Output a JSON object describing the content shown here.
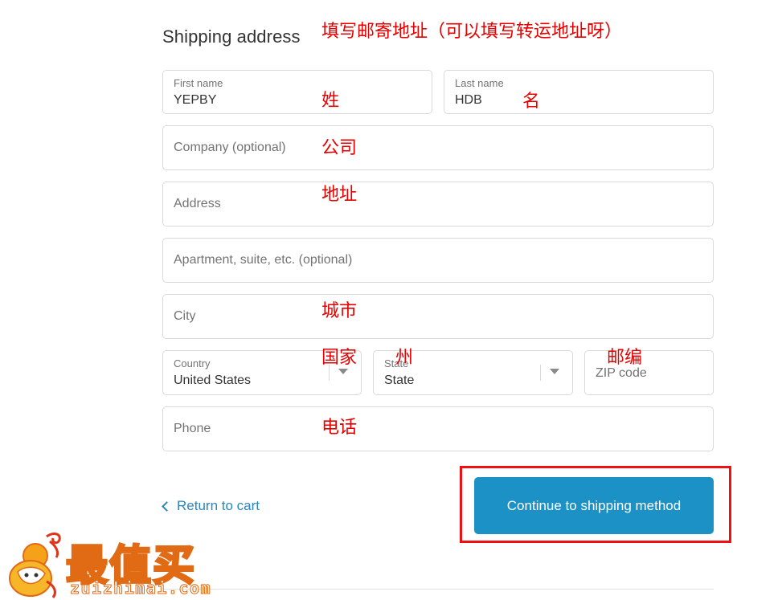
{
  "section": {
    "title": "Shipping address"
  },
  "form": {
    "first_name": {
      "label": "First name",
      "value": "YEPBY"
    },
    "last_name": {
      "label": "Last name",
      "value": "HDB"
    },
    "company": {
      "placeholder": "Company (optional)"
    },
    "address": {
      "placeholder": "Address"
    },
    "apartment": {
      "placeholder": "Apartment, suite, etc. (optional)"
    },
    "city": {
      "placeholder": "City"
    },
    "country": {
      "label": "Country",
      "value": "United States"
    },
    "state": {
      "label": "State",
      "value": "State"
    },
    "zip": {
      "placeholder": "ZIP code"
    },
    "phone": {
      "placeholder": "Phone"
    }
  },
  "annotations": {
    "header": "填写邮寄地址（可以填写转运地址呀）",
    "surname": "姓",
    "given_name": "名",
    "company": "公司",
    "address": "地址",
    "city": "城市",
    "country": "国家",
    "state": "州",
    "zip": "邮编",
    "phone": "电话"
  },
  "actions": {
    "return_label": "Return to cart",
    "continue_label": "Continue to shipping method"
  },
  "watermark": {
    "logo_text": "最值买",
    "logo_url_text": "zuizhimai.com"
  },
  "colors": {
    "accent": "#1b91c6",
    "link": "#2a86bd",
    "annotation": "#e60000",
    "highlight_border": "#ee1111"
  }
}
